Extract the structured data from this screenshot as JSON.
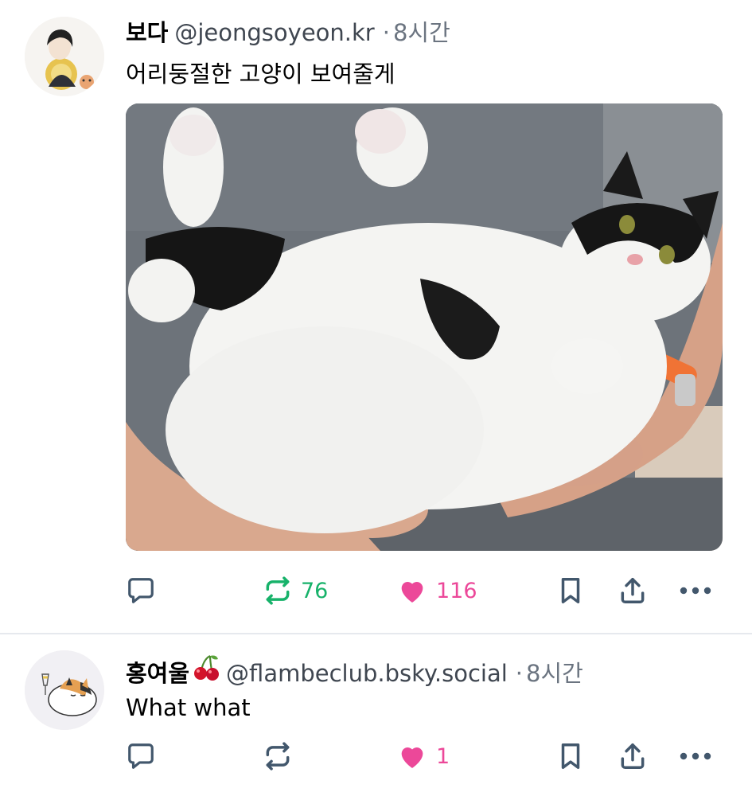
{
  "posts": [
    {
      "display_name": "보다",
      "handle": "@jeongsoyeon.kr",
      "separator": "·",
      "time": "8시간",
      "text": "어리둥절한 고양이 보여줄게",
      "repost_count": "76",
      "like_count": "116",
      "reposted": true,
      "liked": true
    },
    {
      "display_name": "홍여울",
      "display_emoji": "cherry-emoji",
      "handle": "@flambeclub.bsky.social",
      "separator": "·",
      "time": "8시간",
      "text": "What what",
      "repost_count": "",
      "like_count": "1",
      "reposted": false,
      "liked": true
    }
  ],
  "icons": [
    "reply-icon",
    "repost-icon",
    "heart-icon",
    "bookmark-icon",
    "share-icon",
    "more-icon"
  ],
  "colors": {
    "repost_active": "#17b26a",
    "like_active": "#ec4899",
    "icon_default": "#42576c",
    "meta_text": "#6b7480",
    "divider": "#e6e9ee"
  }
}
